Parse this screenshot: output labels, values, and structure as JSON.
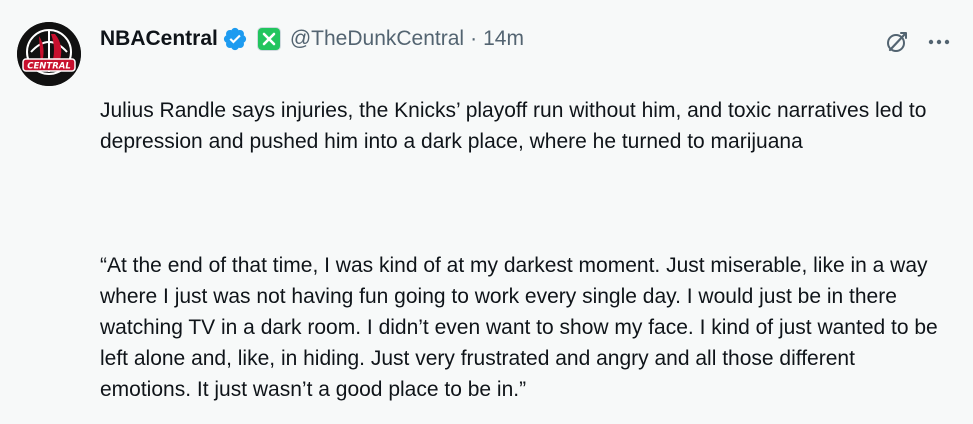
{
  "author": {
    "display_name": "NBACentral",
    "handle": "@TheDunkCentral",
    "separator": "·",
    "time": "14m",
    "avatar_text": "CENTRAL"
  },
  "icons": {
    "verified": "verified-badge-icon",
    "affiliation": "affiliation-x-icon",
    "grok": "grok-icon",
    "more": "more-options-icon"
  },
  "colors": {
    "verified": "#1d9bf0",
    "affiliation": "#22c55e",
    "secondary_text": "#536471"
  },
  "tweet": {
    "paragraph1": "Julius Randle says injuries, the Knicks’ playoff run without him, and toxic narratives led to depression and pushed him into a dark place, where he turned to marijuana",
    "paragraph2": "“At the end of that time, I was kind of at my darkest moment. Just miserable, like in a way where I just was not having fun going to work every single day. I would just be in there watching TV in a dark room. I didn’t even want to show my face. I kind of just wanted to be left alone and, like, in hiding. Just very frustrated and angry and all those different emotions. It just wasn’t a good place to be in.”"
  }
}
